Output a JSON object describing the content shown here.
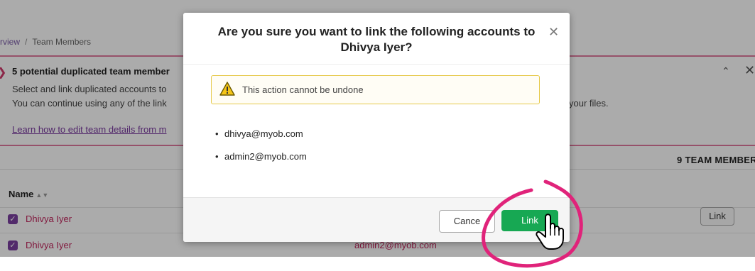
{
  "breadcrumb": {
    "overview": "rview",
    "separator": "/",
    "current": "Team Members"
  },
  "alert": {
    "title": "5 potential duplicated team member",
    "line1": "Select and link duplicated accounts to",
    "line2": "You can continue using any of the link",
    "line2_tail": "your files.",
    "link_text": "Learn how to edit team details from m"
  },
  "team_count": "9 TEAM MEMBER",
  "table": {
    "name_header": "Name",
    "rows": [
      {
        "name": "Dhivya Iyer",
        "email": "",
        "action": "Link"
      },
      {
        "name": "Dhivya Iyer",
        "email": "admin2@myob.com",
        "action": ""
      }
    ]
  },
  "modal": {
    "title": "Are you sure you want to link the following accounts to Dhivya Iyer?",
    "warning": "This action cannot be undone",
    "accounts": [
      "dhivya@myob.com",
      "admin2@myob.com"
    ],
    "cancel_label": "Cance",
    "link_label": "Link"
  },
  "colors": {
    "accent": "#7b3fa0",
    "link_green": "#17a853",
    "highlight": "#e0237a",
    "warning_border": "#e6c94a"
  }
}
